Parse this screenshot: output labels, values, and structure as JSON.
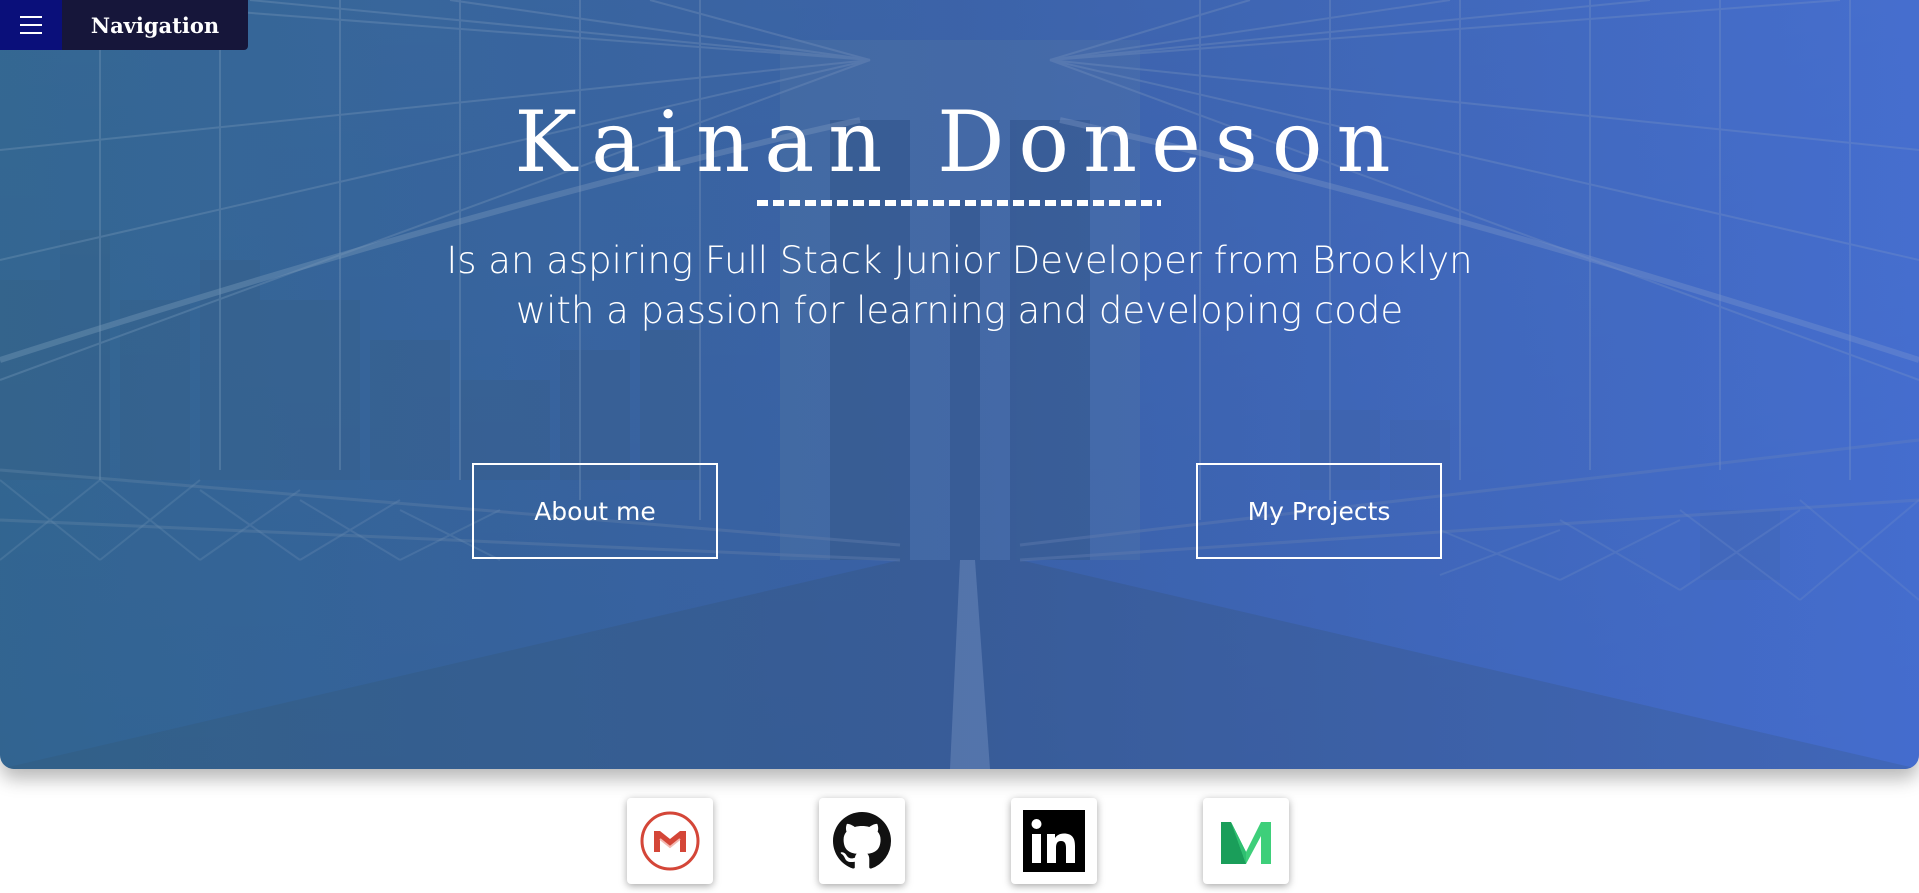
{
  "nav": {
    "menu_icon": "hamburger-menu-icon",
    "title": "Navigation"
  },
  "hero": {
    "name": "Kainan Doneson",
    "tagline_line1": "Is an aspiring Full Stack Junior Developer from Brooklyn",
    "tagline_line2": "with a passion for learning and developing code",
    "about_button": "About me",
    "projects_button": "My Projects",
    "overlay_color": "#3a62aa"
  },
  "social": {
    "links": [
      {
        "icon": "gmail-icon"
      },
      {
        "icon": "github-icon"
      },
      {
        "icon": "linkedin-icon"
      },
      {
        "icon": "medium-icon"
      }
    ]
  },
  "colors": {
    "nav_toggle": "#0a0f7a",
    "nav_title_bg": "#16163a",
    "gmail_red": "#d44638",
    "medium_green": "#2fbf71"
  }
}
